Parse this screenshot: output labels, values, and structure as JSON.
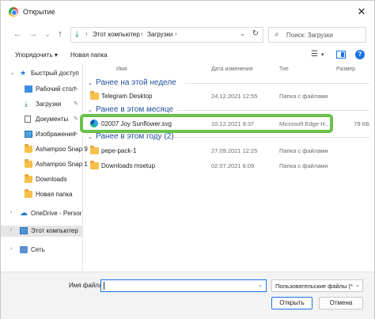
{
  "window": {
    "title": "Открытие",
    "close_symbol": "✕"
  },
  "nav": {
    "back": "←",
    "forward": "→",
    "dropdown": "⌄",
    "up": "↑",
    "breadcrumbs": [
      "Этот компьютер",
      "Загрузки"
    ],
    "separator": "›",
    "address_dropdown": "⌄",
    "refresh": "↻",
    "search_placeholder": "Поиск: Загрузки",
    "search_icon": "⌕"
  },
  "toolbar": {
    "organize": "Упорядочить ▾",
    "new_folder": "Новая папка",
    "view_icon": "☰",
    "view_dropdown": "▾",
    "help": "?"
  },
  "sidebar": {
    "items": [
      {
        "label": "Быстрый доступ",
        "icon": "star-icon",
        "chev": "⌄",
        "pinned": false
      },
      {
        "label": "Рабочий стол",
        "icon": "desktop-icon",
        "pinned": true
      },
      {
        "label": "Загрузки",
        "icon": "download-icon",
        "pinned": true
      },
      {
        "label": "Документы",
        "icon": "document-icon",
        "pinned": true
      },
      {
        "label": "Изображения",
        "icon": "pictures-icon",
        "pinned": true
      },
      {
        "label": "Ashampoo Snap 9",
        "icon": "folder-icon",
        "pinned": false
      },
      {
        "label": "Ashampoo Snap 1",
        "icon": "folder-icon",
        "pinned": false
      },
      {
        "label": "Downloads",
        "icon": "folder-icon",
        "pinned": false
      },
      {
        "label": "Новая папка",
        "icon": "folder-icon",
        "pinned": false
      },
      {
        "label": "OneDrive - Personal",
        "icon": "onedrive-icon",
        "chev": "›",
        "pinned": false
      },
      {
        "label": "Этот компьютер",
        "icon": "computer-icon",
        "chev": "›",
        "pinned": false
      },
      {
        "label": "Сеть",
        "icon": "network-icon",
        "chev": "›",
        "pinned": false
      }
    ],
    "pin_symbol": "✎"
  },
  "columns": {
    "name": "Имя",
    "date": "Дата изменения",
    "type": "Тип",
    "size": "Размер"
  },
  "groups": [
    {
      "label": "Ранее на этой неделе",
      "rows": [
        {
          "name": "Telegram Desktop",
          "date": "24.12.2021 12:55",
          "type": "Папка с файлами",
          "size": "",
          "icon": "folder-icon"
        }
      ]
    },
    {
      "label": "Ранее в этом месяце",
      "rows": [
        {
          "name": "02007 Joy Sunflower.svg",
          "date": "10.12.2021 9:37",
          "type": "Microsoft Edge H...",
          "size": "79 КБ",
          "icon": "edge-icon"
        }
      ]
    },
    {
      "label": "Ранее в этом году (2)",
      "rows": [
        {
          "name": "pepe-pack-1",
          "date": "27.09.2021 12:25",
          "type": "Папка с файлами",
          "size": "",
          "icon": "folder-icon"
        },
        {
          "name": "Downloads msetup",
          "date": "02.07.2021 6:09",
          "type": "Папка с файлами",
          "size": "",
          "icon": "folder-icon"
        }
      ]
    }
  ],
  "group_chevron": "⌄",
  "highlight_color": "#6ac24b",
  "bottom": {
    "filename_label": "Имя файла:",
    "filename_value": "",
    "filetype": "Пользовательские файлы (*.svg",
    "open_button": "Открыть",
    "cancel_button": "Отмена",
    "dropdown": "⌄"
  }
}
